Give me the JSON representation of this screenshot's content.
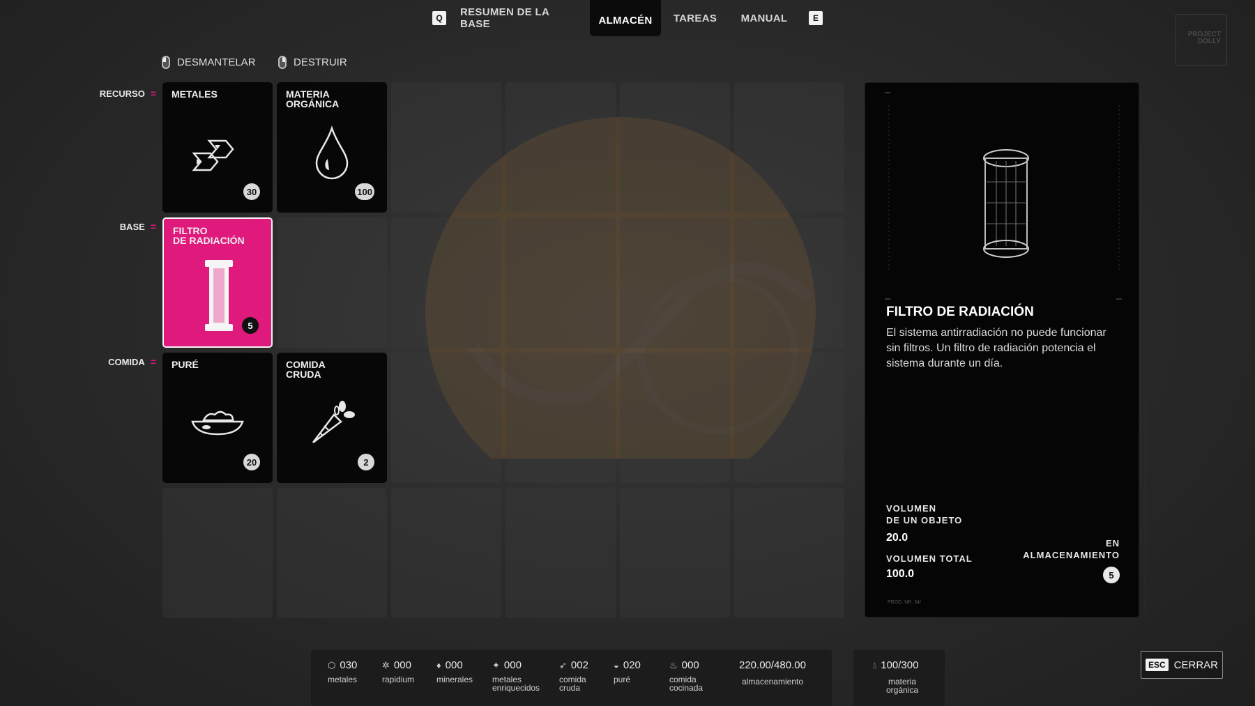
{
  "topnav": {
    "key_left": "Q",
    "key_right": "E",
    "tabs": [
      {
        "label": "RESUMEN DE LA BASE",
        "active": false
      },
      {
        "label": "ALMACÉN",
        "active": true
      },
      {
        "label": "TAREAS",
        "active": false
      },
      {
        "label": "MANUAL",
        "active": false
      }
    ],
    "logo_text": "PROJECT DOLLY"
  },
  "actions": {
    "dismantle": "DESMANTELAR",
    "destroy": "DESTRUIR"
  },
  "categories": {
    "resource": "RECURSO",
    "base": "BASE",
    "food": "COMIDA",
    "mark": "="
  },
  "items": [
    {
      "name": "METALES",
      "count": "30",
      "icon": "metal-ingots-icon"
    },
    {
      "name": "MATERIA\nORGÁNICA",
      "count": "100",
      "icon": "drop-icon"
    },
    {
      "name": "FILTRO\nDE RADIACIÓN",
      "count": "5",
      "icon": "filter-cylinder-icon"
    },
    {
      "name": "PURÉ",
      "count": "20",
      "icon": "bowl-icon"
    },
    {
      "name": "COMIDA\nCRUDA",
      "count": "2",
      "icon": "carrot-icon"
    }
  ],
  "detail": {
    "title": "FILTRO DE RADIACIÓN",
    "description": "El sistema antirradiación no puede funcionar sin filtros. Un filtro de radiación potencia el sistema durante un día.",
    "unit_volume_label": "VOLUMEN\nDE UN OBJETO",
    "unit_volume": "20.0",
    "total_volume_label": "VOLUMEN TOTAL",
    "total_volume": "100.0",
    "stored_label": "EN\nALMACENAMIENTO",
    "stored_count": "5",
    "tiny_text": "PROD. NR. 34/"
  },
  "bottombar": {
    "resources": [
      {
        "value": "030",
        "label": "metales",
        "icon": "metal-icon"
      },
      {
        "value": "000",
        "label": "rapidium",
        "icon": "gear-icon"
      },
      {
        "value": "000",
        "label": "minerales",
        "icon": "crystal-icon"
      },
      {
        "value": "000",
        "label": "metales\nenriquecidos",
        "icon": "enriched-metal-icon"
      },
      {
        "value": "002",
        "label": "comida\ncruda",
        "icon": "carrot-icon"
      },
      {
        "value": "020",
        "label": "puré",
        "icon": "bowl-icon"
      },
      {
        "value": "000",
        "label": "comida\ncocinada",
        "icon": "pot-icon"
      }
    ],
    "capacity": "220.00/480.00",
    "capacity_label": "almacenamiento",
    "organic": "100/300",
    "organic_label": "materia\norgánica"
  },
  "close": {
    "key": "ESC",
    "label": "CERRAR"
  },
  "colors": {
    "accent": "#e0197d",
    "card": "#070707",
    "background": "#2b2b2b"
  }
}
